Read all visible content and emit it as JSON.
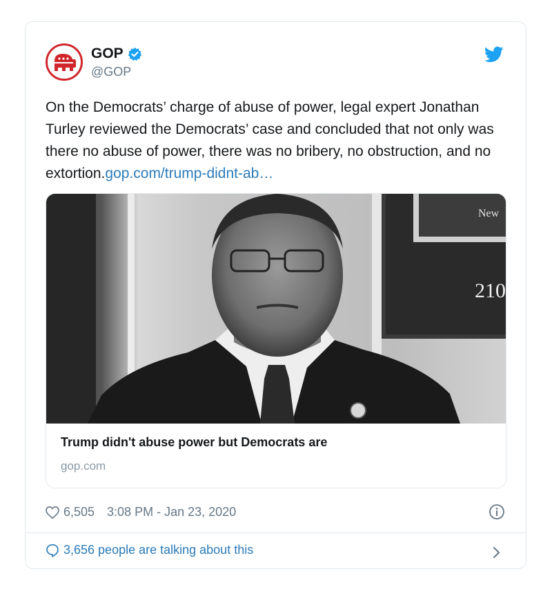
{
  "tweet": {
    "display_name": "GOP",
    "handle": "@GOP",
    "avatar_icon": "gop-elephant-logo",
    "verified_icon": "verified-badge-icon",
    "brand_icon": "twitter-bird-icon",
    "body": "On the Democrats’ charge of abuse of power, legal expert Jonathan Turley reviewed the Democrats’ case and concluded that not only was there no abuse of power, there was no bribery, no obstruction, and no extortion.",
    "link_text": "gop.com/trump-didnt-ab…",
    "likes": "6,505",
    "timestamp": "3:08 PM - Jan 23, 2020",
    "talking_text": "3,656 people are talking about this"
  },
  "card": {
    "photo_signs": {
      "plaque_top": "New",
      "room_number": "210"
    },
    "title": "Trump didn't abuse power but Democrats are",
    "domain": "gop.com"
  },
  "colors": {
    "link": "#2b7bb9",
    "brand_red": "#d0262b",
    "twitter_blue": "#1da1f2",
    "muted": "#657786",
    "border": "#e1e8ed"
  }
}
